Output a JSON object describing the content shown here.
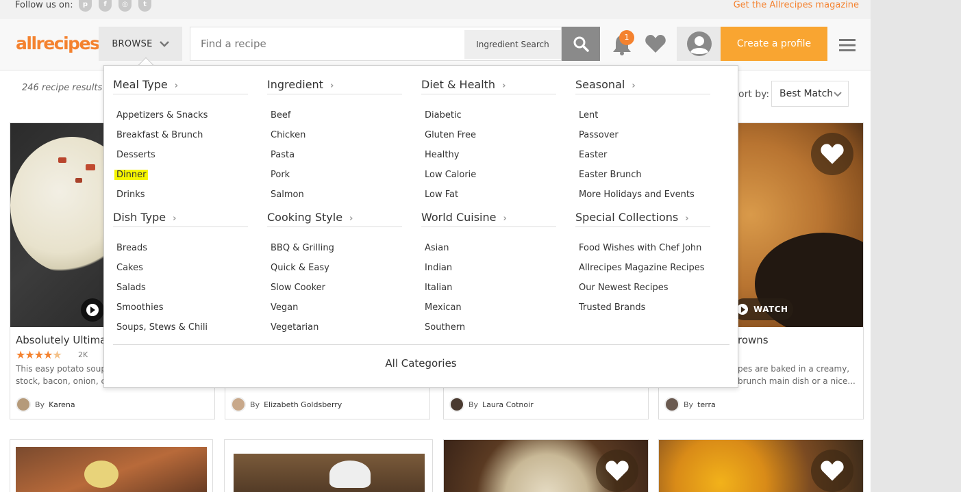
{
  "topbar": {
    "follow_label": "Follow us on:",
    "social": [
      "pinterest-icon",
      "facebook-icon",
      "instagram-icon",
      "twitter-icon"
    ],
    "magazine_link": "Get the Allrecipes magazine"
  },
  "header": {
    "logo": "allrecipes",
    "browse_label": "BROWSE",
    "search_placeholder": "Find a recipe",
    "ingredient_search_label": "Ingredient Search",
    "notification_count": "1",
    "create_profile_label": "Create a profile"
  },
  "results": {
    "count_text": "246 recipe results i",
    "sort_label": "ort by:",
    "sort_value": "Best Match"
  },
  "dropdown": {
    "columns": [
      {
        "sections": [
          {
            "title": "Meal Type",
            "items": [
              "Appetizers & Snacks",
              "Breakfast & Brunch",
              "Desserts",
              "Dinner",
              "Drinks"
            ]
          },
          {
            "title": "Dish Type",
            "items": [
              "Breads",
              "Cakes",
              "Salads",
              "Smoothies",
              "Soups, Stews & Chili"
            ]
          }
        ]
      },
      {
        "sections": [
          {
            "title": "Ingredient",
            "items": [
              "Beef",
              "Chicken",
              "Pasta",
              "Pork",
              "Salmon"
            ]
          },
          {
            "title": "Cooking Style",
            "items": [
              "BBQ & Grilling",
              "Quick & Easy",
              "Slow Cooker",
              "Vegan",
              "Vegetarian"
            ]
          }
        ]
      },
      {
        "sections": [
          {
            "title": "Diet & Health",
            "items": [
              "Diabetic",
              "Gluten Free",
              "Healthy",
              "Low Calorie",
              "Low Fat"
            ]
          },
          {
            "title": "World Cuisine",
            "items": [
              "Asian",
              "Indian",
              "Italian",
              "Mexican",
              "Southern"
            ]
          }
        ]
      },
      {
        "sections": [
          {
            "title": "Seasonal",
            "items": [
              "Lent",
              "Passover",
              "Easter",
              "Easter Brunch",
              "More Holidays and Events"
            ]
          },
          {
            "title": "Special Collections",
            "items": [
              "Food Wishes with Chef John",
              "Allrecipes Magazine Recipes",
              "Our Newest Recipes",
              "Trusted Brands"
            ]
          }
        ]
      }
    ],
    "highlighted_item": "Dinner",
    "all_categories_label": "All Categories"
  },
  "cards": [
    {
      "title": "Absolutely Ultimat",
      "reviews": "2K",
      "desc_line1": "This easy potato soup",
      "desc_line2": "stock, bacon, onion, c",
      "by_prefix": "By",
      "author": "Karena"
    },
    {
      "by_prefix": "By",
      "author": "Elizabeth Goldsberry"
    },
    {
      "by_prefix": "By",
      "author": "Laura Cotnoir"
    },
    {
      "title": "rowns",
      "desc_line1": "pes are baked in a creamy,",
      "desc_line2": "brunch main dish or a nice...",
      "by_prefix": "By",
      "author": "terra",
      "watch_label": "WATCH"
    }
  ],
  "colors": {
    "brand_orange": "#f4822f",
    "create_button": "#f9a531",
    "highlight": "#f5f500"
  }
}
